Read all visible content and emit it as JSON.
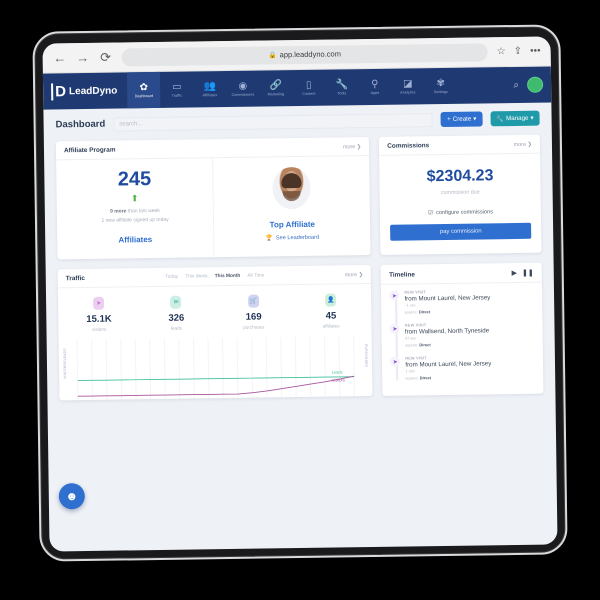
{
  "browser": {
    "back_icon": "←",
    "forward_icon": "→",
    "reload_icon": "⟳",
    "lock_icon": "🔒",
    "url": "app.leaddyno.com",
    "bookmark_icon": "☆",
    "share_icon": "⇪",
    "more_icon": "•••"
  },
  "topnav": {
    "brand_mark": "D",
    "brand_name": "LeadDyno",
    "items": [
      {
        "label": "Dashboard",
        "icon": "✿",
        "name": "dashboard",
        "active": true
      },
      {
        "label": "Traffic",
        "icon": "▭",
        "name": "traffic",
        "active": false
      },
      {
        "label": "Affiliates",
        "icon": "👥",
        "name": "affiliates",
        "active": false
      },
      {
        "label": "Commissions",
        "icon": "◉",
        "name": "commissions",
        "active": false
      },
      {
        "label": "Marketing",
        "icon": "🔗",
        "name": "marketing",
        "active": false
      },
      {
        "label": "Content",
        "icon": "▯",
        "name": "content",
        "active": false
      },
      {
        "label": "Tools",
        "icon": "🔧",
        "name": "tools",
        "active": false
      },
      {
        "label": "Apps",
        "icon": "⚲",
        "name": "apps",
        "active": false
      },
      {
        "label": "Analytics",
        "icon": "◪",
        "name": "analytics",
        "active": false
      },
      {
        "label": "Settings",
        "icon": "✾",
        "name": "settings",
        "active": false
      }
    ],
    "search_icon": "⌕",
    "avatar_label": ""
  },
  "pagehead": {
    "title": "Dashboard",
    "search_placeholder": "search...",
    "create_label": "Create",
    "create_icon": "+",
    "create_caret": "▾",
    "manage_label": "Manage",
    "manage_icon": "🔧",
    "manage_caret": "▾"
  },
  "affiliate_program": {
    "title": "Affiliate Program",
    "more": "more ❯",
    "count": "245",
    "trend_icon": "⬆",
    "sub_line1_strong": "9 more",
    "sub_line1_rest": " than last week",
    "sub_line2": "1 new affiliate signed up today",
    "affiliates_link": "Affiliates",
    "top_affiliate_link": "Top Affiliate",
    "leaderboard_icon": "🏆",
    "leaderboard_label": "See Leaderboard"
  },
  "commissions": {
    "title": "Commissions",
    "more": "more ❯",
    "amount": "$2304.23",
    "amount_sub": "commission due",
    "configure_icon": "☑",
    "configure_label": "configure commissions",
    "pay_label": "pay commission"
  },
  "traffic": {
    "title": "Traffic",
    "more": "more ❯",
    "tabs": [
      {
        "label": "Today",
        "active": false
      },
      {
        "label": "This Week",
        "active": false
      },
      {
        "label": "This Month",
        "active": true
      },
      {
        "label": "All Time",
        "active": false
      }
    ],
    "stats": [
      {
        "value": "15.1K",
        "label": "visitors",
        "icon": "➤",
        "color": "#eccff0",
        "icon_color": "#c26fd6"
      },
      {
        "value": "326",
        "label": "leads",
        "icon": "✉",
        "color": "#cdeee6",
        "icon_color": "#3fae99"
      },
      {
        "value": "169",
        "label": "purchases",
        "icon": "🛒",
        "color": "#ccd3f3",
        "icon_color": "#4157c4"
      },
      {
        "value": "45",
        "label": "affiliates",
        "icon": "👤",
        "color": "#cdeedb",
        "icon_color": "#3fae72"
      }
    ],
    "chart_axis_left": "VISITORS/LEADS",
    "chart_axis_right": "PURCHASES",
    "series_leads_label": "Leads",
    "series_visitors_label": "Visitors"
  },
  "timeline": {
    "title": "Timeline",
    "play_icon": "▶",
    "pause_icon": "❚❚",
    "items": [
      {
        "kind": "NEW VISIT",
        "icon": "➤",
        "text": "from Mount Laurel, New Jersey",
        "time": "~1 sec",
        "source_label": "source:",
        "source": "Direct"
      },
      {
        "kind": "NEW VISIT",
        "icon": "➤",
        "text": "from Wallsend, North Tyneside",
        "time": "37 sec",
        "source_label": "source:",
        "source": "Direct"
      },
      {
        "kind": "NEW VISIT",
        "icon": "➤",
        "text": "from Mount Laurel, New Jersey",
        "time": "1 min",
        "source_label": "source:",
        "source": "Direct"
      }
    ]
  },
  "chat": {
    "icon": "☻"
  },
  "colors": {
    "nav_bg": "#1f3a73",
    "accent_blue": "#2f6fd0",
    "accent_teal": "#1f9aa8",
    "leads_green": "#3fbf9b",
    "visitors_purple": "#a8559f",
    "page_bg": "#eef1f6"
  },
  "chart_data": {
    "type": "line",
    "title": "",
    "xlabel": "",
    "ylabel": "VISITORS/LEADS",
    "y2label": "PURCHASES",
    "grid": true,
    "legend": "inline-right",
    "x": [
      1,
      2,
      3,
      4,
      5,
      6,
      7,
      8,
      9,
      10,
      11,
      12,
      13,
      14,
      15,
      16,
      17,
      18,
      19,
      20
    ],
    "series": [
      {
        "name": "Leads",
        "color": "#3fbf9b",
        "values": [
          30,
          30,
          30,
          30,
          30,
          30,
          30,
          30,
          30,
          30,
          30,
          30,
          30,
          30,
          30,
          30,
          30,
          30,
          30,
          30
        ]
      },
      {
        "name": "Visitors",
        "color": "#a8559f",
        "values": [
          0,
          0,
          0,
          0,
          0,
          0,
          0,
          0,
          0,
          0,
          0,
          0,
          2,
          5,
          9,
          13,
          17,
          21,
          26,
          31
        ]
      }
    ],
    "ylim": [
      0,
      100
    ]
  }
}
